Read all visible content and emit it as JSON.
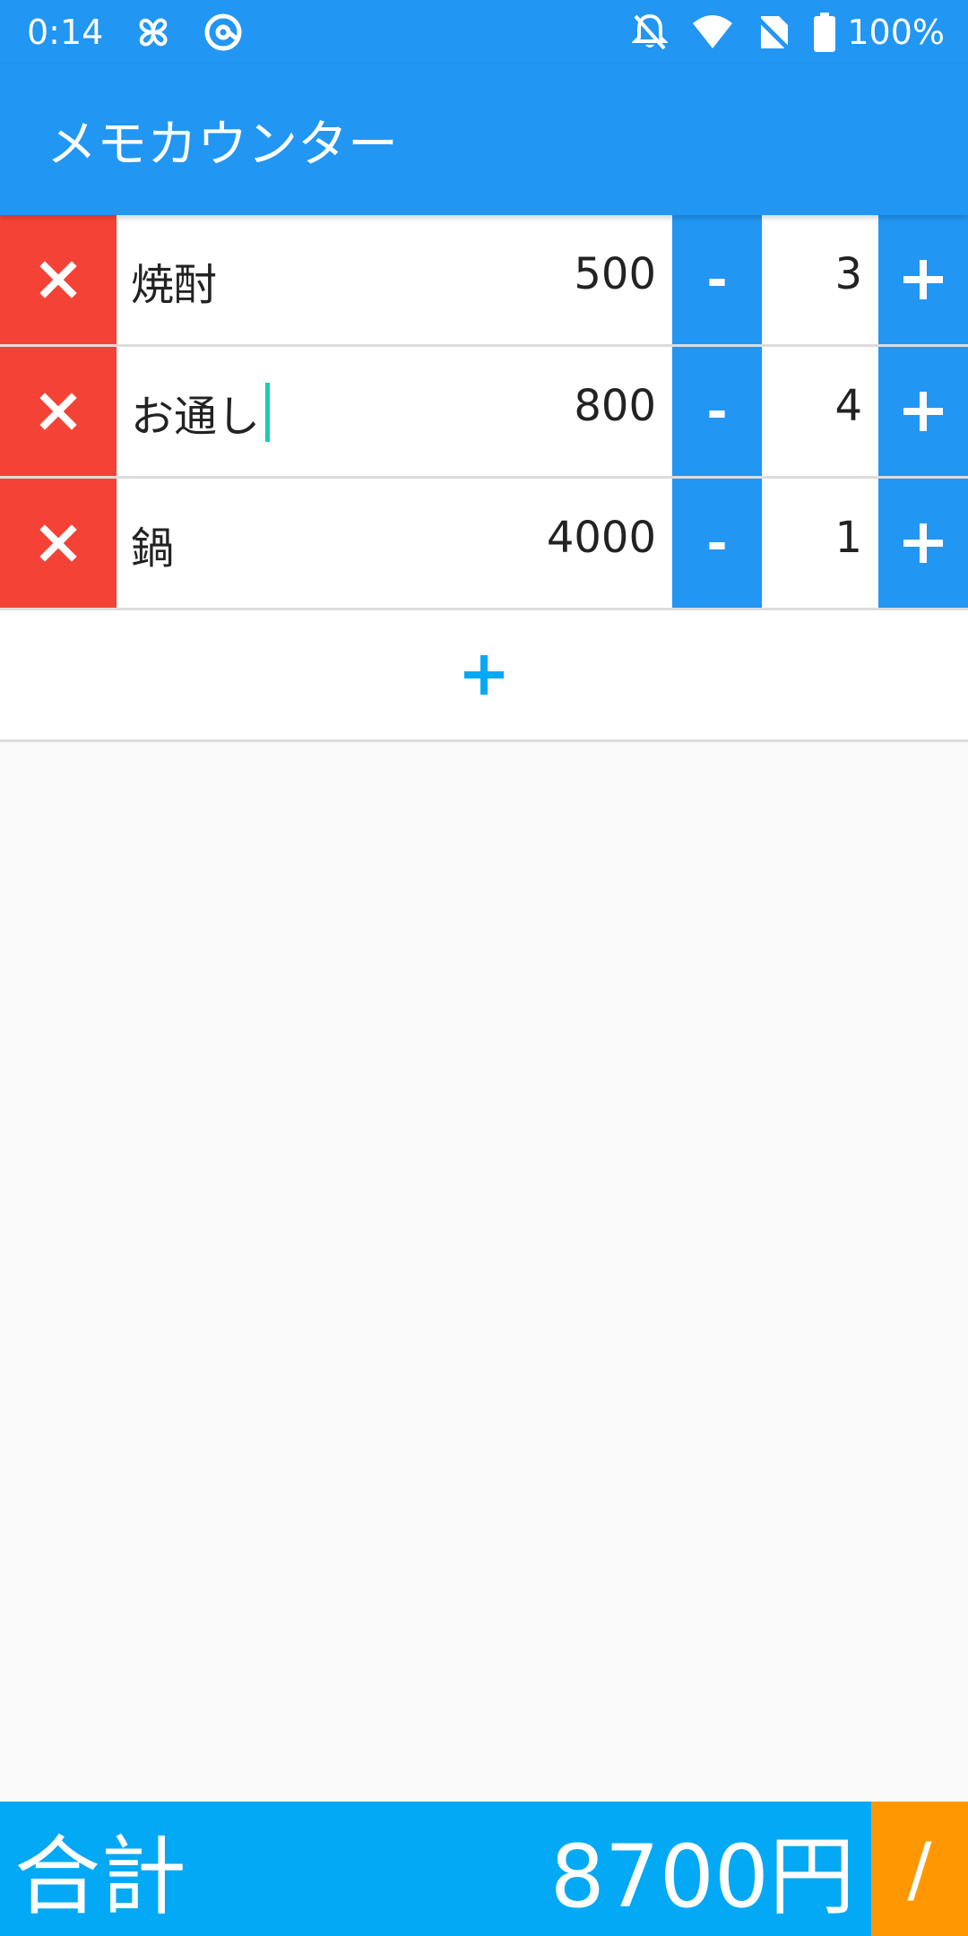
{
  "status_bar": {
    "time": "0:14",
    "battery": "100%",
    "icons": [
      "pinwheel-icon",
      "at-sign-icon",
      "bell-off-icon",
      "wifi-icon",
      "no-sim-icon",
      "battery-icon"
    ]
  },
  "app_bar": {
    "title": "メモカウンター"
  },
  "items": [
    {
      "name": "焼酎",
      "price": "500",
      "minus": "-",
      "qty": "3"
    },
    {
      "name": "お通し",
      "price": "800",
      "minus": "-",
      "qty": "4"
    },
    {
      "name": "鍋",
      "price": "4000",
      "minus": "-",
      "qty": "1"
    }
  ],
  "footer": {
    "total_label": "合計",
    "total_value": "8700円",
    "divide_label": "/"
  },
  "colors": {
    "primary": "#2196f3",
    "delete": "#f44336",
    "footer": "#03a9f4",
    "divide": "#ff9800",
    "cursor": "#1fc9b8"
  }
}
